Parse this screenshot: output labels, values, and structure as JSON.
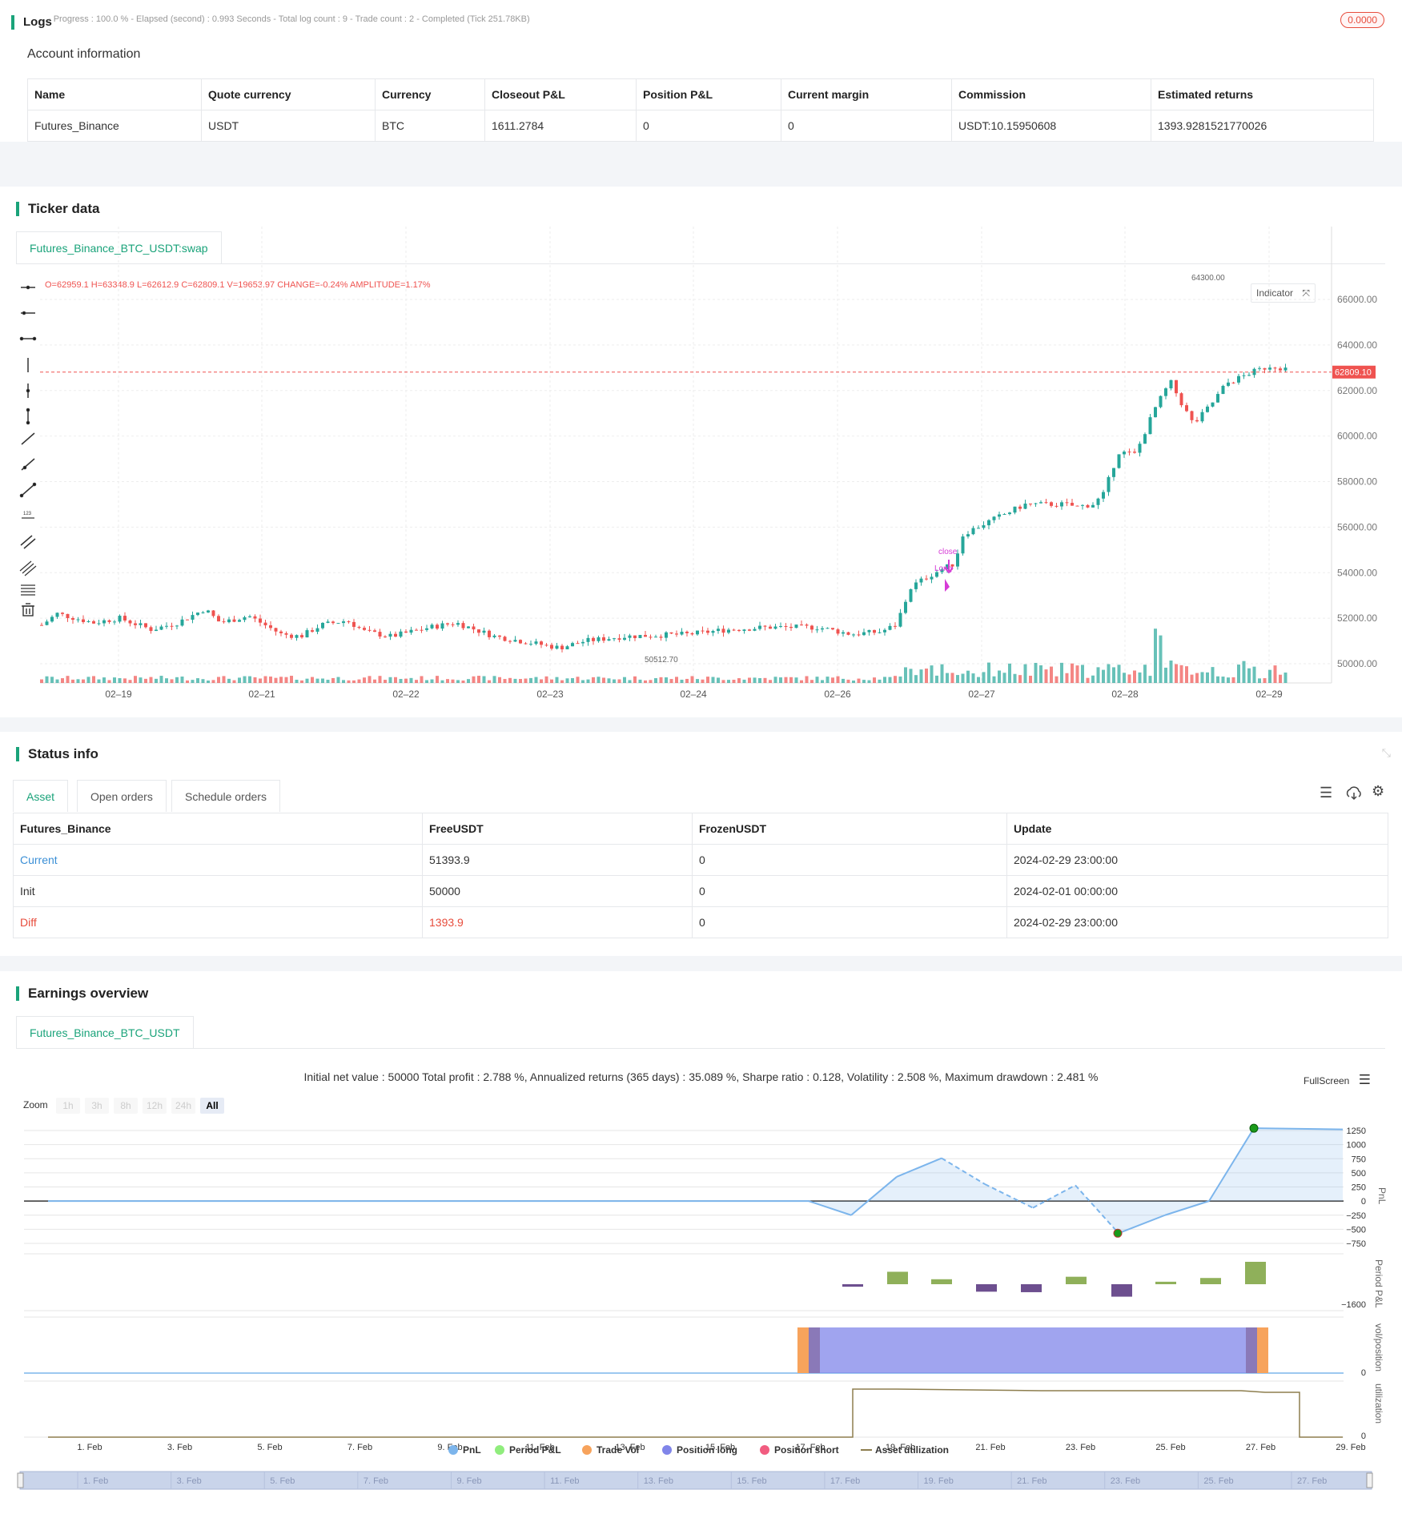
{
  "logs": {
    "title": "Logs",
    "status": "- Progress : 100.0 % - Elapsed (second) : 0.993  Seconds - Total log count : 9 - Trade count : 2 - Completed (Tick 251.78KB)",
    "badge": "0.0000"
  },
  "account": {
    "title": "Account information",
    "headers": [
      "Name",
      "Quote currency",
      "Currency",
      "Closeout P&L",
      "Position P&L",
      "Current margin",
      "Commission",
      "Estimated returns"
    ],
    "row": [
      "Futures_Binance",
      "USDT",
      "BTC",
      "1611.2784",
      "0",
      "0",
      "USDT:10.15950608",
      "1393.9281521770026"
    ]
  },
  "ticker": {
    "title": "Ticker data",
    "tab": "Futures_Binance_BTC_USDT:swap",
    "ohlc": "O=62959.1 H=63348.9 L=62612.9 C=62809.1 V=19653.97 CHANGE=-0.24% AMPLITUDE=1.17%",
    "indicator_label": "Indicator",
    "price_tag": "62809.10",
    "high_label": "64300.00",
    "low_label": "50512.70",
    "close_label": "close",
    "long_label": "Long",
    "y_ticks": [
      "66000.00",
      "64000.00",
      "62000.00",
      "60000.00",
      "58000.00",
      "56000.00",
      "54000.00",
      "52000.00",
      "50000.00"
    ],
    "x_ticks": [
      "02–19",
      "02–21",
      "02–22",
      "02–23",
      "02–24",
      "02–26",
      "02–27",
      "02–28",
      "02–29"
    ],
    "up_color": "#26a69a",
    "down_color": "#ef5350"
  },
  "status": {
    "title": "Status info",
    "tabs": [
      "Asset",
      "Open orders",
      "Schedule orders"
    ],
    "headers": [
      "Futures_Binance",
      "FreeUSDT",
      "FrozenUSDT",
      "Update"
    ],
    "rows": [
      [
        "Current",
        "51393.9",
        "0",
        "2024-02-29 23:00:00"
      ],
      [
        "Init",
        "50000",
        "0",
        "2024-02-01 00:00:00"
      ],
      [
        "Diff",
        "1393.9",
        "0",
        "2024-02-29 23:00:00"
      ]
    ]
  },
  "earnings": {
    "title": "Earnings overview",
    "tab": "Futures_Binance_BTC_USDT",
    "summary": "Initial net value : 50000 Total profit : 2.788 %, Annualized returns (365 days) : 35.089 %, Sharpe ratio : 0.128, Volatility : 2.508 %, Maximum drawdown : 2.481 %",
    "fullscreen": "FullScreen",
    "zoom_label": "Zoom",
    "zoom_buttons": [
      "1h",
      "3h",
      "8h",
      "12h",
      "24h",
      "All"
    ],
    "pnl_ticks": [
      "1250",
      "1000",
      "750",
      "500",
      "250",
      "0",
      "−250",
      "−500",
      "−750"
    ],
    "axis_titles": [
      "PnL",
      "Period P&L",
      "vol/position",
      "utilization"
    ],
    "period_tick": "−1600",
    "zero_tick": "0",
    "x_ticks": [
      "1. Feb",
      "3. Feb",
      "5. Feb",
      "7. Feb",
      "9. Feb",
      "11. Feb",
      "13. Feb",
      "15. Feb",
      "17. Feb",
      "19. Feb",
      "21. Feb",
      "23. Feb",
      "25. Feb",
      "27. Feb",
      "29. Feb"
    ],
    "nav_ticks": [
      "1. Feb",
      "3. Feb",
      "5. Feb",
      "7. Feb",
      "9. Feb",
      "11. Feb",
      "13. Feb",
      "15. Feb",
      "17. Feb",
      "19. Feb",
      "21. Feb",
      "23. Feb",
      "25. Feb",
      "27. Feb"
    ],
    "legend": [
      {
        "label": "PnL",
        "color": "#7cb5ec"
      },
      {
        "label": "Period P&L",
        "color": "#90ed7d"
      },
      {
        "label": "Trade Vol",
        "color": "#f7a35c"
      },
      {
        "label": "Position long",
        "color": "#8085e9"
      },
      {
        "label": "Position short",
        "color": "#f15c80"
      },
      {
        "label": "Asset utilization",
        "color": "#8d7e4e"
      }
    ]
  },
  "chart_data": {
    "type": "line",
    "title": "",
    "x": [
      "Feb 17",
      "Feb 18",
      "Feb 19",
      "Feb 20",
      "Feb 21",
      "Feb 22",
      "Feb 23",
      "Feb 24",
      "Feb 25",
      "Feb 26",
      "Feb 27",
      "Feb 28"
    ],
    "series": [
      {
        "name": "PnL",
        "values": [
          0,
          -250,
          430,
          760,
          300,
          -120,
          280,
          -570,
          -250,
          0,
          1290,
          1270
        ]
      },
      {
        "name": "Period P&L",
        "values": [
          -100,
          500,
          200,
          -300,
          -320,
          300,
          -500,
          100,
          250,
          900
        ]
      }
    ],
    "ylim": [
      -750,
      1250
    ]
  }
}
